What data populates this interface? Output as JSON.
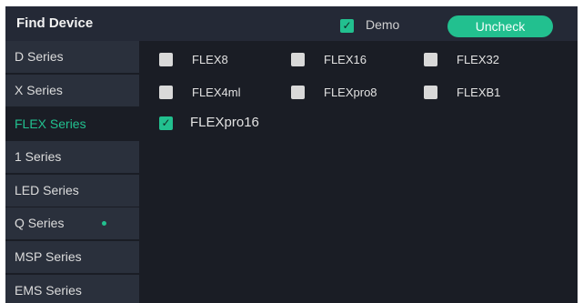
{
  "header": {
    "title": "Find Device",
    "demo_label": "Demo",
    "demo_checked": true,
    "uncheck_label": "Uncheck"
  },
  "sidebar": {
    "items": [
      {
        "label": "D Series",
        "active": false
      },
      {
        "label": "X Series",
        "active": false
      },
      {
        "label": "FLEX Series",
        "active": true
      },
      {
        "label": "1 Series",
        "active": false
      },
      {
        "label": "LED Series",
        "active": false
      },
      {
        "label": "Q Series",
        "active": false,
        "indicator": true
      },
      {
        "label": "MSP Series",
        "active": false
      },
      {
        "label": "EMS Series",
        "active": false
      }
    ]
  },
  "devices": [
    {
      "label": "FLEX8",
      "checked": false
    },
    {
      "label": "FLEX16",
      "checked": false
    },
    {
      "label": "FLEX32",
      "checked": false
    },
    {
      "label": "FLEX4ml",
      "checked": false
    },
    {
      "label": "FLEXpro8",
      "checked": false
    },
    {
      "label": "FLEXB1",
      "checked": false
    },
    {
      "label": "FLEXpro16",
      "checked": true
    }
  ],
  "colors": {
    "accent": "#22c08f",
    "panel_bg": "#1a1d25",
    "sidebar_bg": "#2a303c",
    "header_bg": "#242936"
  }
}
